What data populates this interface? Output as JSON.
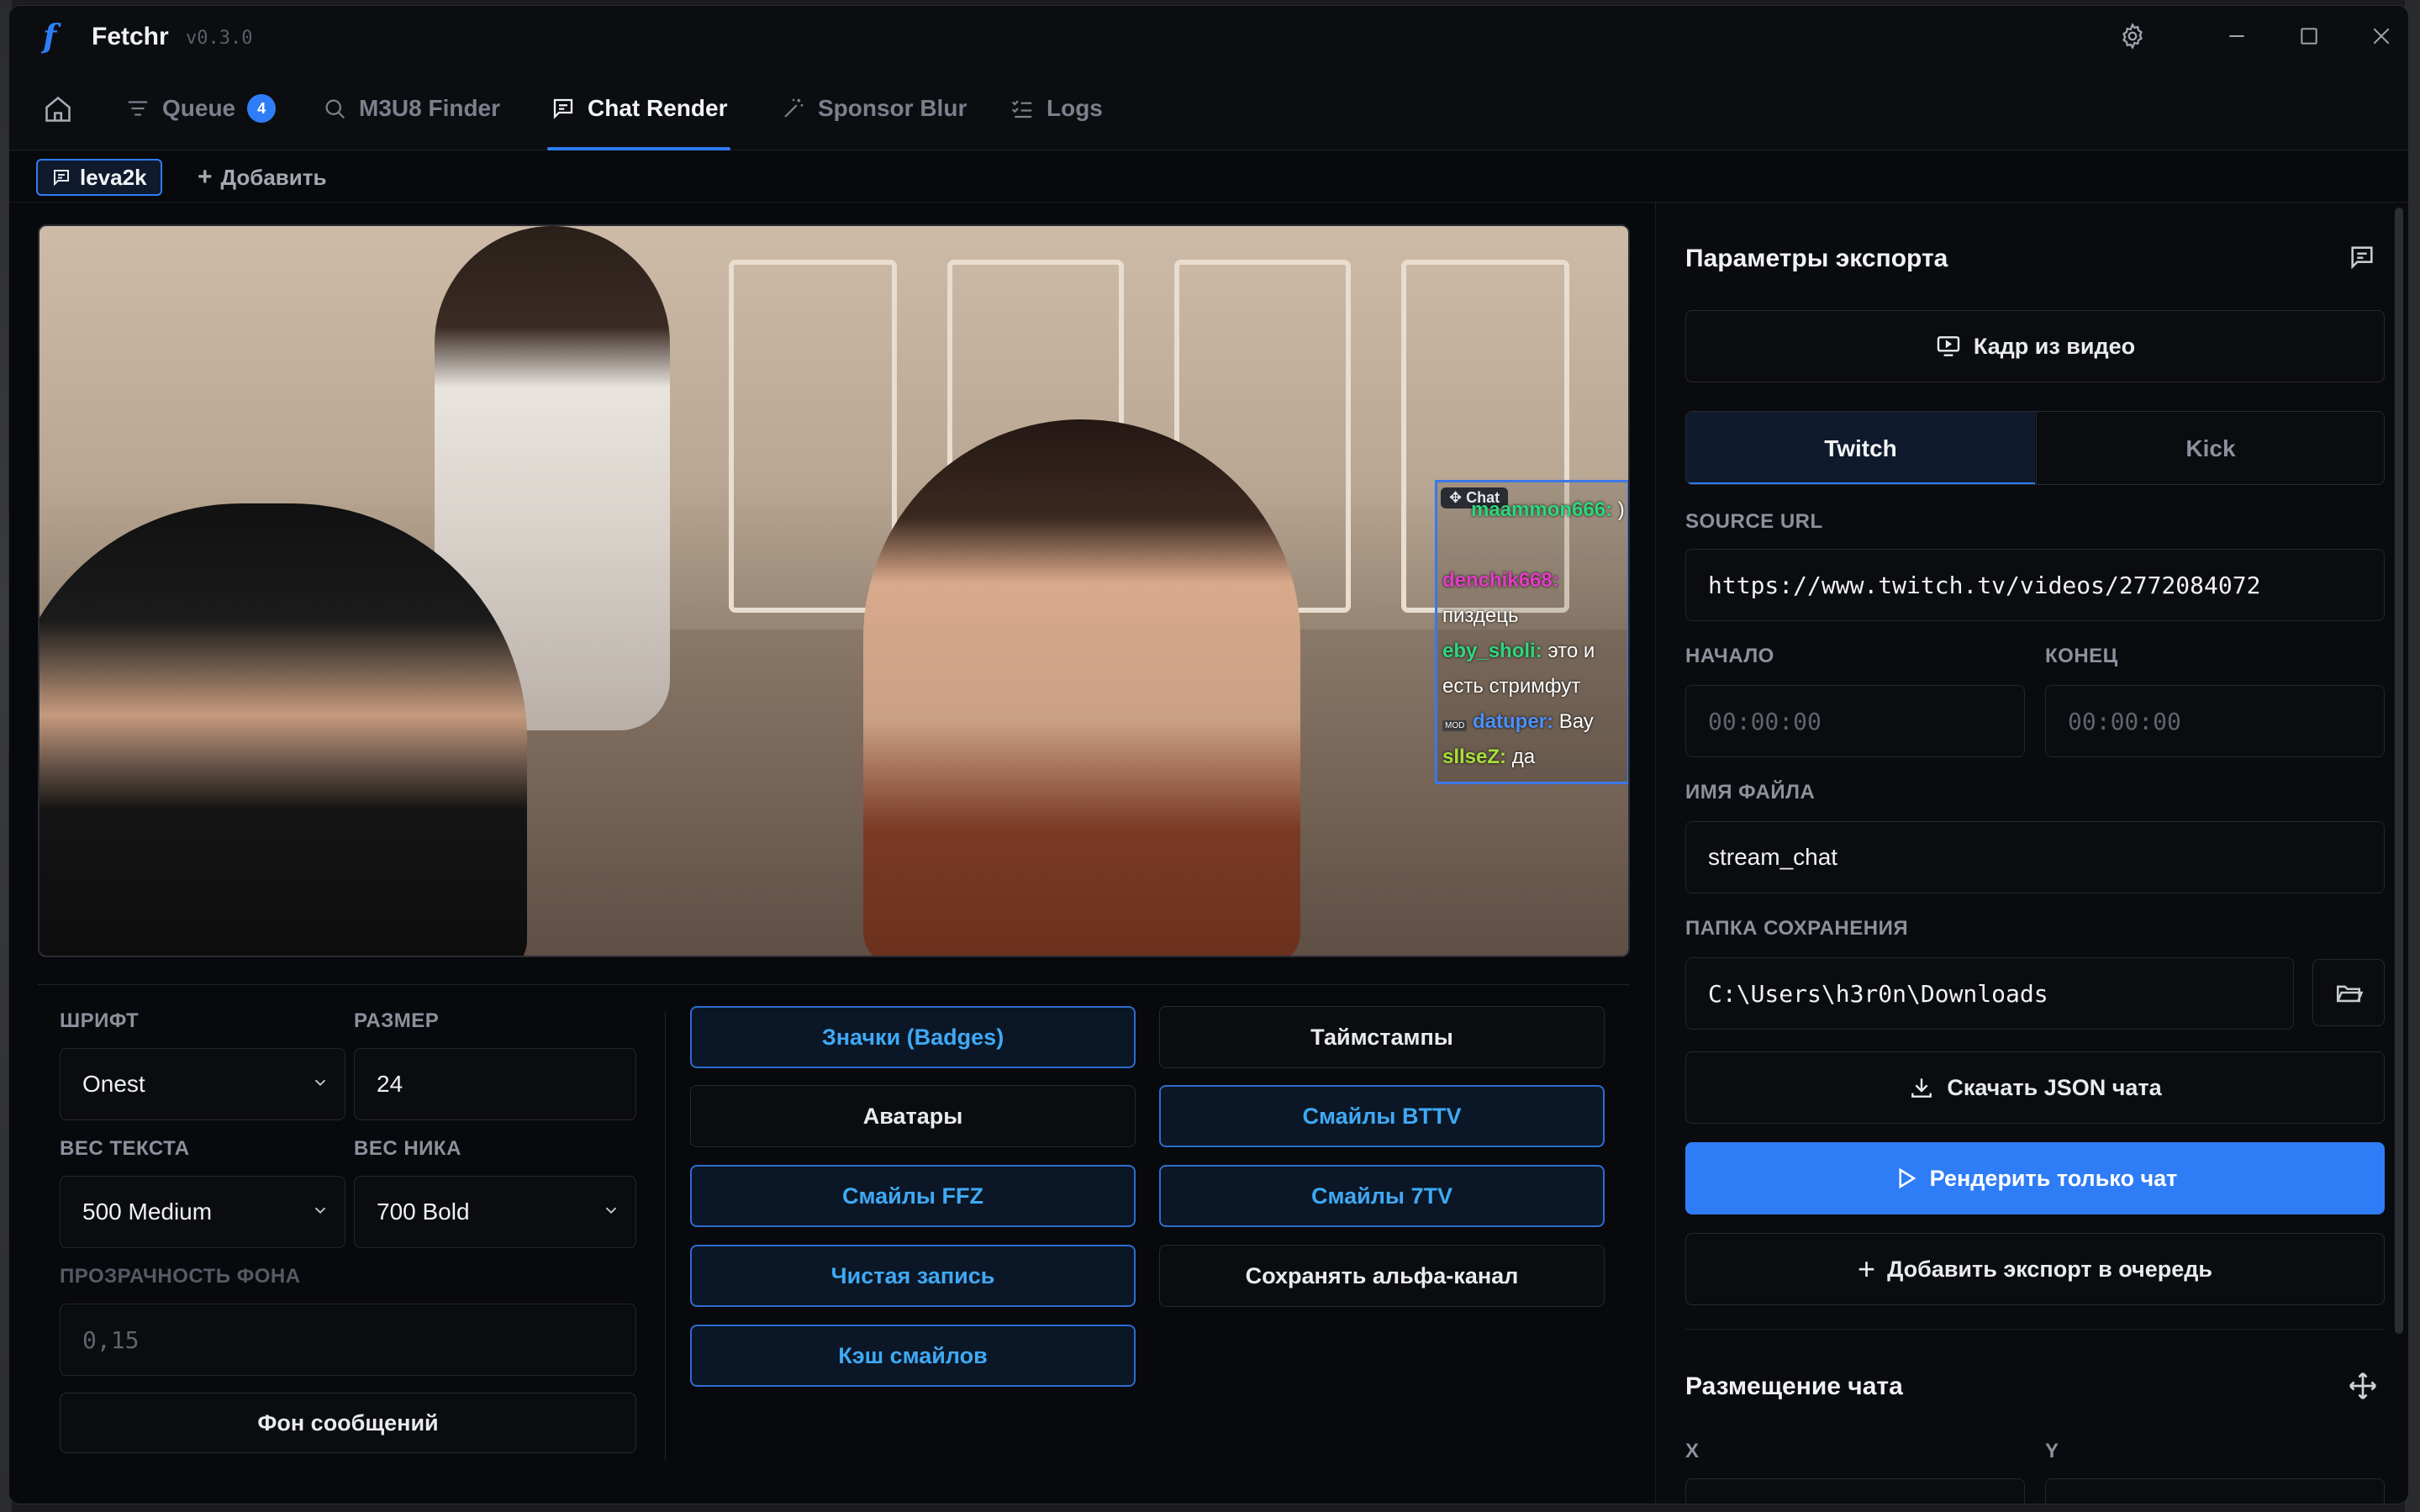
{
  "app": {
    "name": "Fetchr",
    "version": "v0.3.0"
  },
  "tabs": [
    {
      "label": "Queue",
      "badge": "4"
    },
    {
      "label": "M3U8 Finder"
    },
    {
      "label": "Chat Render"
    },
    {
      "label": "Sponsor Blur"
    },
    {
      "label": "Logs"
    }
  ],
  "subbar": {
    "channel": "leva2k",
    "add_label": "Добавить"
  },
  "chat_overlay": {
    "tag": "Chat",
    "lines": [
      {
        "nick": "maammon666:",
        "text": ")"
      },
      {
        "nick": "denchik668:",
        "text": ""
      },
      {
        "nick": "",
        "text": "пиздець"
      },
      {
        "nick": "eby_sholi:",
        "text": "это и"
      },
      {
        "nick": "",
        "text": "есть стримфут"
      },
      {
        "nick": "datuper:",
        "text": "Вау",
        "badge": "MOD"
      },
      {
        "nick": "sllseZ:",
        "text": "да"
      }
    ]
  },
  "settings": {
    "font_label": "ШРИФТ",
    "font_value": "Onest",
    "size_label": "РАЗМЕР",
    "size_value": "24",
    "text_weight_label": "ВЕС ТЕКСТА",
    "text_weight_value": "500 Medium",
    "nick_weight_label": "ВЕС НИКА",
    "nick_weight_value": "700 Bold",
    "bg_opacity_label": "ПРОЗРАЧНОСТЬ ФОНА",
    "bg_opacity_placeholder": "0,15",
    "message_bg_label": "Фон сообщений"
  },
  "toggles": [
    {
      "label": "Значки (Badges)",
      "on": true
    },
    {
      "label": "Таймстампы",
      "on": false
    },
    {
      "label": "Аватары",
      "on": false
    },
    {
      "label": "Смайлы BTTV",
      "on": true
    },
    {
      "label": "Смайлы FFZ",
      "on": true
    },
    {
      "label": "Смайлы 7TV",
      "on": true
    },
    {
      "label": "Чистая запись",
      "on": true
    },
    {
      "label": "Сохранять альфа-канал",
      "on": false
    },
    {
      "label": "Кэш смайлов",
      "on": true
    }
  ],
  "export": {
    "title": "Параметры экспорта",
    "frame_button": "Кадр из видео",
    "platforms": [
      "Twitch",
      "Kick"
    ],
    "active_platform": "Twitch",
    "source_url_label": "SOURCE URL",
    "source_url_value": "https://www.twitch.tv/videos/2772084072",
    "start_label": "НАЧАЛО",
    "start_placeholder": "00:00:00",
    "end_label": "КОНЕЦ",
    "end_placeholder": "00:00:00",
    "filename_label": "ИМЯ ФАЙЛА",
    "filename_value": "stream_chat",
    "folder_label": "ПАПКА СОХРАНЕНИЯ",
    "folder_value": "C:\\Users\\h3r0n\\Downloads",
    "download_json": "Скачать JSON чата",
    "render_chat": "Рендерить только чат",
    "add_to_queue": "Добавить экспорт в очередь"
  },
  "placement": {
    "title": "Размещение чата",
    "x_label": "X",
    "y_label": "Y"
  },
  "colors": {
    "accent": "#2f7df6",
    "toggle_on_text": "#3fa9f5",
    "background": "#08090c"
  }
}
